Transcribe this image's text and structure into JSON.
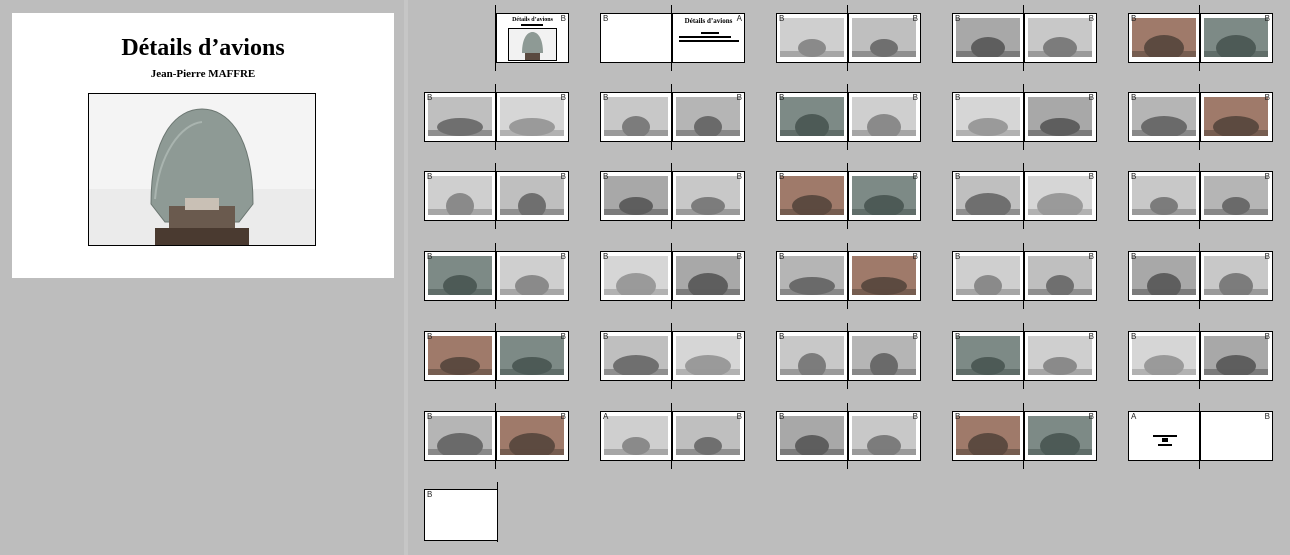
{
  "cover": {
    "title": "Détails d’avions",
    "author": "Jean-Pierre MAFFRE"
  },
  "labels": {
    "B": "B",
    "A": "A"
  },
  "first_spread": {
    "left_label": "",
    "right_label": "B",
    "mini_title": "Détails d’avions"
  },
  "second_spread": {
    "left_label": "B",
    "right_label": "A",
    "title": "Détails d’avions"
  },
  "spreads": [
    {
      "l": "B",
      "r": "B"
    },
    {
      "l": "B",
      "r": "B"
    },
    {
      "l": "B",
      "r": "B"
    },
    {
      "l": "B",
      "r": "B"
    },
    {
      "l": "B",
      "r": "B"
    },
    {
      "l": "B",
      "r": "B"
    },
    {
      "l": "B",
      "r": "B"
    },
    {
      "l": "B",
      "r": "B"
    },
    {
      "l": "B",
      "r": "B"
    },
    {
      "l": "B",
      "r": "B"
    },
    {
      "l": "B",
      "r": "B"
    },
    {
      "l": "B",
      "r": "B"
    },
    {
      "l": "B",
      "r": "B"
    },
    {
      "l": "B",
      "r": "B"
    },
    {
      "l": "B",
      "r": "B"
    },
    {
      "l": "B",
      "r": "B"
    },
    {
      "l": "B",
      "r": "B"
    },
    {
      "l": "B",
      "r": "B"
    },
    {
      "l": "B",
      "r": "B"
    },
    {
      "l": "B",
      "r": "B"
    },
    {
      "l": "B",
      "r": "B"
    },
    {
      "l": "B",
      "r": "B"
    },
    {
      "l": "B",
      "r": "B"
    },
    {
      "l": "B",
      "r": "B"
    },
    {
      "l": "A",
      "r": "B"
    },
    {
      "l": "B",
      "r": "B"
    },
    {
      "l": "B",
      "r": "B"
    },
    {
      "l": "A",
      "r": "B"
    }
  ],
  "last_page": {
    "label": "B"
  },
  "colors": {
    "background": "#bdbdbd",
    "page": "#ffffff",
    "border": "#000000"
  }
}
